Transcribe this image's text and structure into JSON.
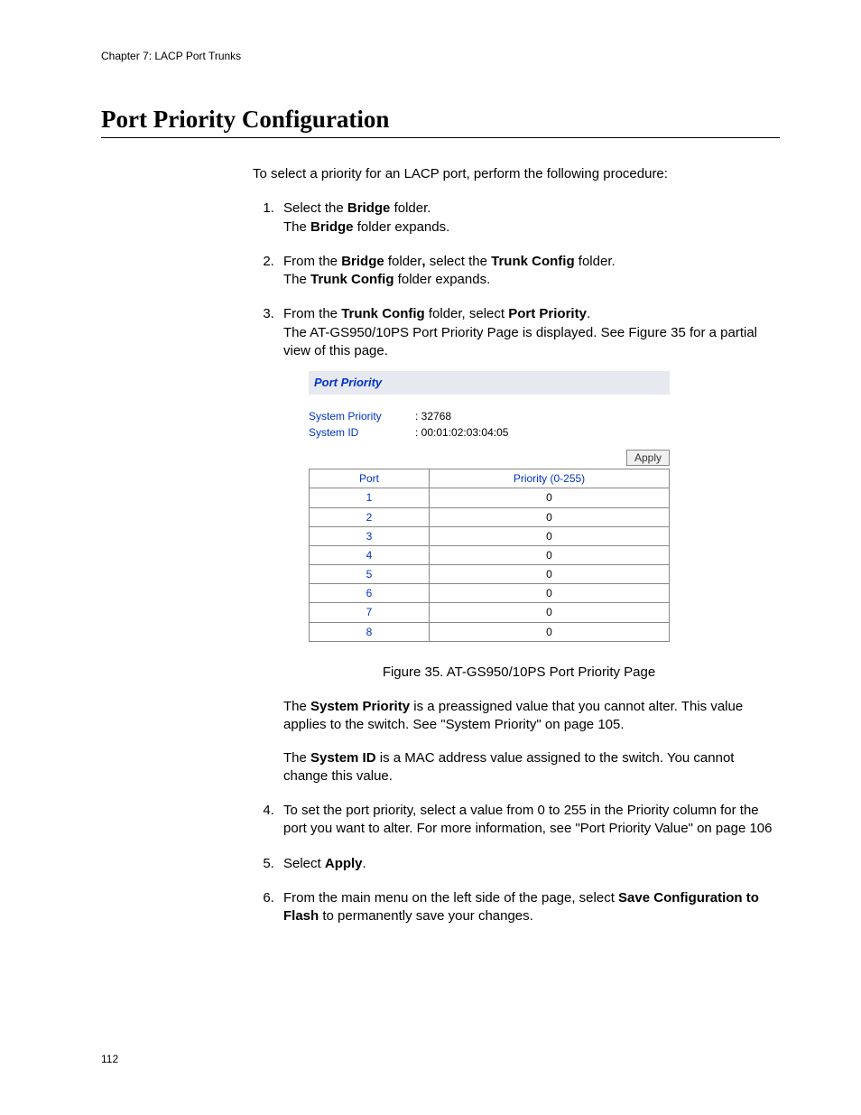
{
  "chapter": "Chapter 7: LACP Port Trunks",
  "title": "Port Priority Configuration",
  "intro": "To select a priority for an LACP port, perform the following procedure:",
  "steps": {
    "s1a": "Select the ",
    "s1b": " folder.",
    "s1c": "The ",
    "s1d": " folder expands.",
    "s2a": "From the ",
    "s2b": " folder",
    "s2c": " select the ",
    "s2d": " folder.",
    "s2e": "The ",
    "s2f": " folder expands.",
    "s3a": "From the ",
    "s3b": " folder, select ",
    "s3c": ".",
    "s3d": "The AT-GS950/10PS Port Priority Page is displayed. See Figure 35 for a partial view of this page.",
    "s4": "To set the port priority, select a value from 0 to 255 in the Priority column for the port you want to alter. For more information, see \"Port Priority Value\" on page 106",
    "s5a": "Select ",
    "s5b": ".",
    "s6a": "From the main menu on the left side of the page, select ",
    "s6b": " to permanently save your changes."
  },
  "bold": {
    "bridge": "Bridge",
    "trunk_config": "Trunk Config",
    "port_priority": "Port Priority",
    "system_priority": "System Priority",
    "system_id": "System ID",
    "apply": "Apply",
    "save_cfg": "Save Configuration to Flash"
  },
  "figure": {
    "title": "Port Priority",
    "sys_priority_label": "System Priority",
    "sys_priority_value": ": 32768",
    "sys_id_label": "System ID",
    "sys_id_value": ": 00:01:02:03:04:05",
    "apply_label": "Apply",
    "col_port": "Port",
    "col_priority": "Priority (0-255)",
    "rows": [
      {
        "port": "1",
        "pri": "0"
      },
      {
        "port": "2",
        "pri": "0"
      },
      {
        "port": "3",
        "pri": "0"
      },
      {
        "port": "4",
        "pri": "0"
      },
      {
        "port": "5",
        "pri": "0"
      },
      {
        "port": "6",
        "pri": "0"
      },
      {
        "port": "7",
        "pri": "0"
      },
      {
        "port": "8",
        "pri": "0"
      }
    ],
    "caption": "Figure 35. AT-GS950/10PS Port Priority Page"
  },
  "after_figure": {
    "p1a": "The ",
    "p1b": " is a preassigned value that you cannot alter. This value applies to the switch. See \"System Priority\" on page 105.",
    "p2a": "The ",
    "p2b": " is a MAC address value assigned to the switch. You cannot change this value."
  },
  "comma_sep": ",",
  "page_number": "112"
}
